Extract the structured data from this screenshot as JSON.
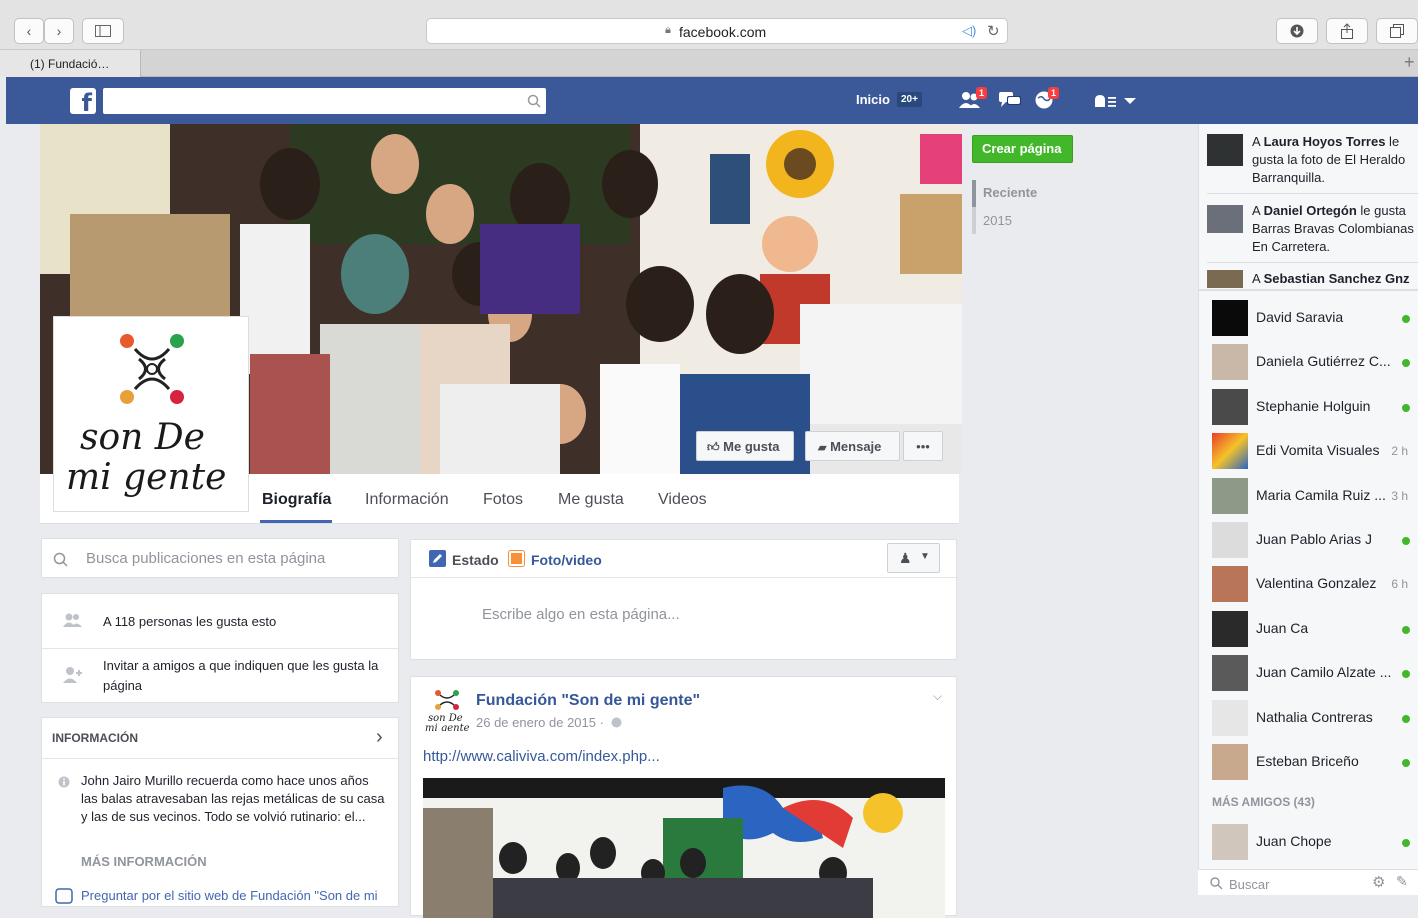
{
  "browser": {
    "url": "facebook.com",
    "tab_title": "(1) Fundació…",
    "new_tab": "+"
  },
  "topbar": {
    "logo": "f",
    "home_label": "Inicio",
    "home_count": "20+",
    "friend_requests_badge": "1",
    "notifications_badge": "1"
  },
  "page": {
    "logo_text_line1": "son De",
    "logo_text_line2": "mi gente",
    "actions": {
      "like": "Me gusta",
      "message": "Mensaje",
      "more": "•••"
    },
    "tabs": [
      "Biografía",
      "Información",
      "Fotos",
      "Me gusta",
      "Videos"
    ],
    "create_page": "Crear página",
    "timeline_filter": {
      "recent": "Reciente",
      "year": "2015"
    }
  },
  "left": {
    "search_placeholder": "Busca publicaciones en esta página",
    "likes_text": "A 118 personas les gusta esto",
    "invite_text": "Invitar a amigos a que indiquen que les gusta la página",
    "info_header": "INFORMACIÓN",
    "info_body": "John Jairo Murillo recuerda como hace unos años las balas atravesaban las rejas metálicas de su casa y las de sus vecinos. Todo se volvió rutinario: el...",
    "more_info": "MÁS INFORMACIÓN",
    "bottom_cut": "Preguntar por el sitio web de Fundación \"Son de mi"
  },
  "composer": {
    "status": "Estado",
    "photo_video": "Foto/video",
    "placeholder": "Escribe algo en esta página..."
  },
  "post": {
    "author": "Fundación \"Son de mi gente\"",
    "date": "26 de enero de 2015 ·",
    "link": "http://www.caliviva.com/index.php..."
  },
  "ticker": [
    {
      "prefix": "A ",
      "name": "Laura Hoyos Torres",
      "rest": " le gusta la foto de El Heraldo Barranquilla."
    },
    {
      "prefix": "A ",
      "name": "Daniel Ortegón",
      "rest": " le gusta Barras Bravas Colombianas En Carretera."
    },
    {
      "prefix": "A ",
      "name": "Sebastian Sanchez Gnz",
      "rest": ""
    }
  ],
  "chat": [
    {
      "name": "David Saravia",
      "time": "",
      "online": true
    },
    {
      "name": "Daniela Gutiérrez C...",
      "time": "",
      "online": true
    },
    {
      "name": "Stephanie Holguin",
      "time": "",
      "online": true
    },
    {
      "name": "Edi Vomita Visuales",
      "time": "2 h",
      "online": false
    },
    {
      "name": "Maria Camila Ruiz ...",
      "time": "3 h",
      "online": false
    },
    {
      "name": "Juan Pablo Arias J",
      "time": "",
      "online": true
    },
    {
      "name": "Valentina Gonzalez",
      "time": "6 h",
      "online": false
    },
    {
      "name": "Juan Ca",
      "time": "",
      "online": true
    },
    {
      "name": "Juan Camilo Alzate ...",
      "time": "",
      "online": true
    },
    {
      "name": "Nathalia Contreras",
      "time": "",
      "online": true
    },
    {
      "name": "Esteban Briceño",
      "time": "",
      "online": true
    }
  ],
  "more_friends": "MÁS AMIGOS (43)",
  "more_friend": {
    "name": "Juan Chope",
    "online": true
  },
  "chat_search": "Buscar",
  "colors": {
    "fb_blue": "#3b5998",
    "green": "#42b72a",
    "link": "#365899"
  }
}
